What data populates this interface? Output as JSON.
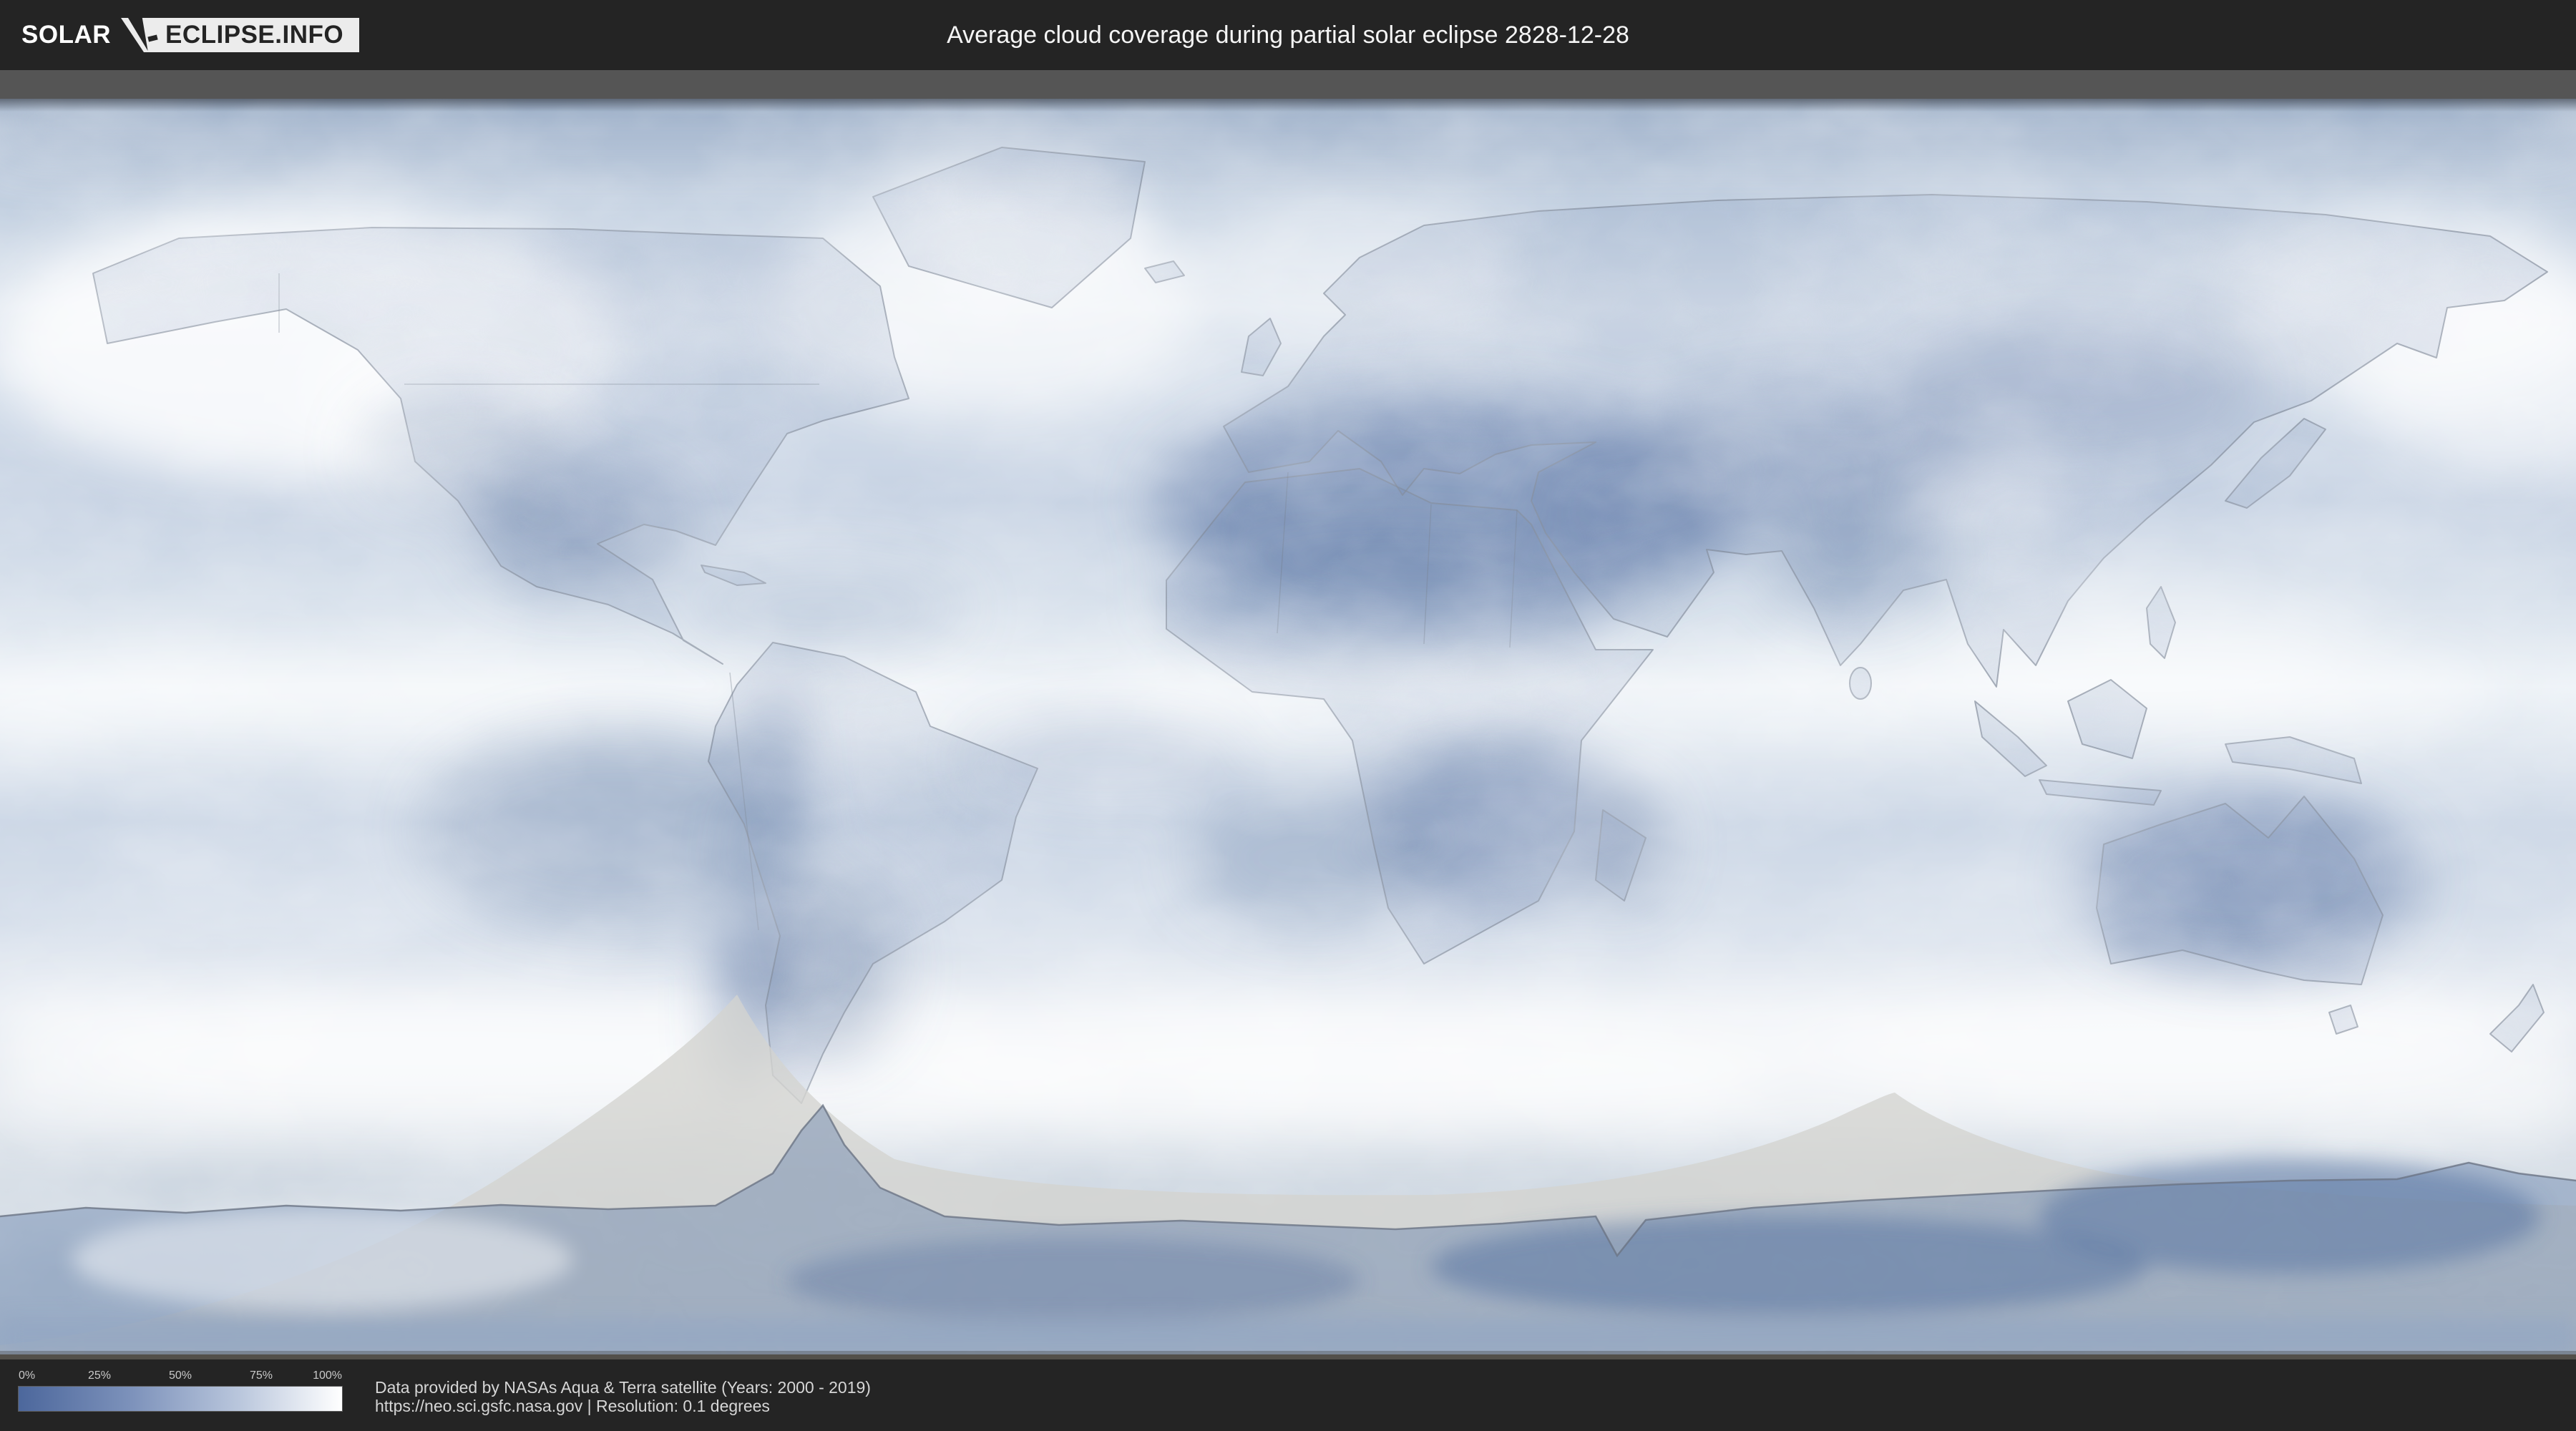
{
  "brand": {
    "solar": "SOLAR",
    "domain": "ECLIPSE.INFO"
  },
  "header": {
    "title": "Average cloud coverage during partial solar eclipse 2828-12-28"
  },
  "legend": {
    "ticks": [
      "0%",
      "25%",
      "50%",
      "75%",
      "100%"
    ],
    "gradient_start": "#4c679c",
    "gradient_end": "#ffffff"
  },
  "footer": {
    "line1": "Data provided by NASAs Aqua & Terra satellite (Years: 2000 - 2019)",
    "line2": "https://neo.sci.gsfc.nasa.gov | Resolution: 0.1 degrees"
  },
  "map": {
    "type": "world-map",
    "subject": "average cloud coverage (blue = low cloud, white = high cloud)",
    "overlay": "gray cone-shaped shading rising from the Antarctic region (two peaks, near South America and south of Australia)",
    "colors": {
      "header_bg": "#242424",
      "divider_gray": "#555555",
      "low_cloud_blue": "#4c679c",
      "high_cloud_white": "#ffffff",
      "overlay_gray": "#d4d4d0"
    }
  }
}
